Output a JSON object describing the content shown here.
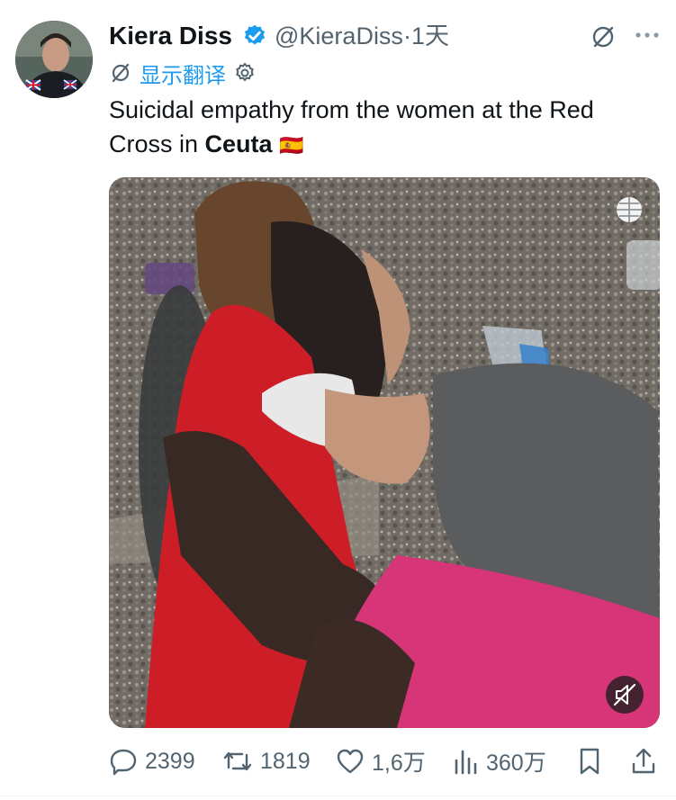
{
  "author": {
    "name": "Kiera Diss",
    "handle": "@KieraDiss",
    "separator": "·",
    "time": "1天"
  },
  "translate": {
    "label": "显示翻译"
  },
  "tweet": {
    "text_line1": "Suicidal empathy from the women at the Red",
    "text_line2_prefix": "Cross in ",
    "text_bold": "Ceuta",
    "flag": "🇪🇸"
  },
  "metrics": {
    "replies": "2399",
    "retweets": "1819",
    "likes": "1,6万",
    "views": "360万"
  },
  "colors": {
    "accent": "#1d9bf0",
    "muted": "#536471",
    "text": "#0f1419",
    "reddress": "#d8202b",
    "shorts": "#e23a83"
  },
  "icons": [
    "verified-badge-icon",
    "grok-icon",
    "more-icon",
    "translate-icon",
    "settings-icon",
    "globe-icon",
    "mute-icon",
    "reply-icon",
    "retweet-icon",
    "like-icon",
    "views-icon",
    "bookmark-icon",
    "share-icon"
  ]
}
